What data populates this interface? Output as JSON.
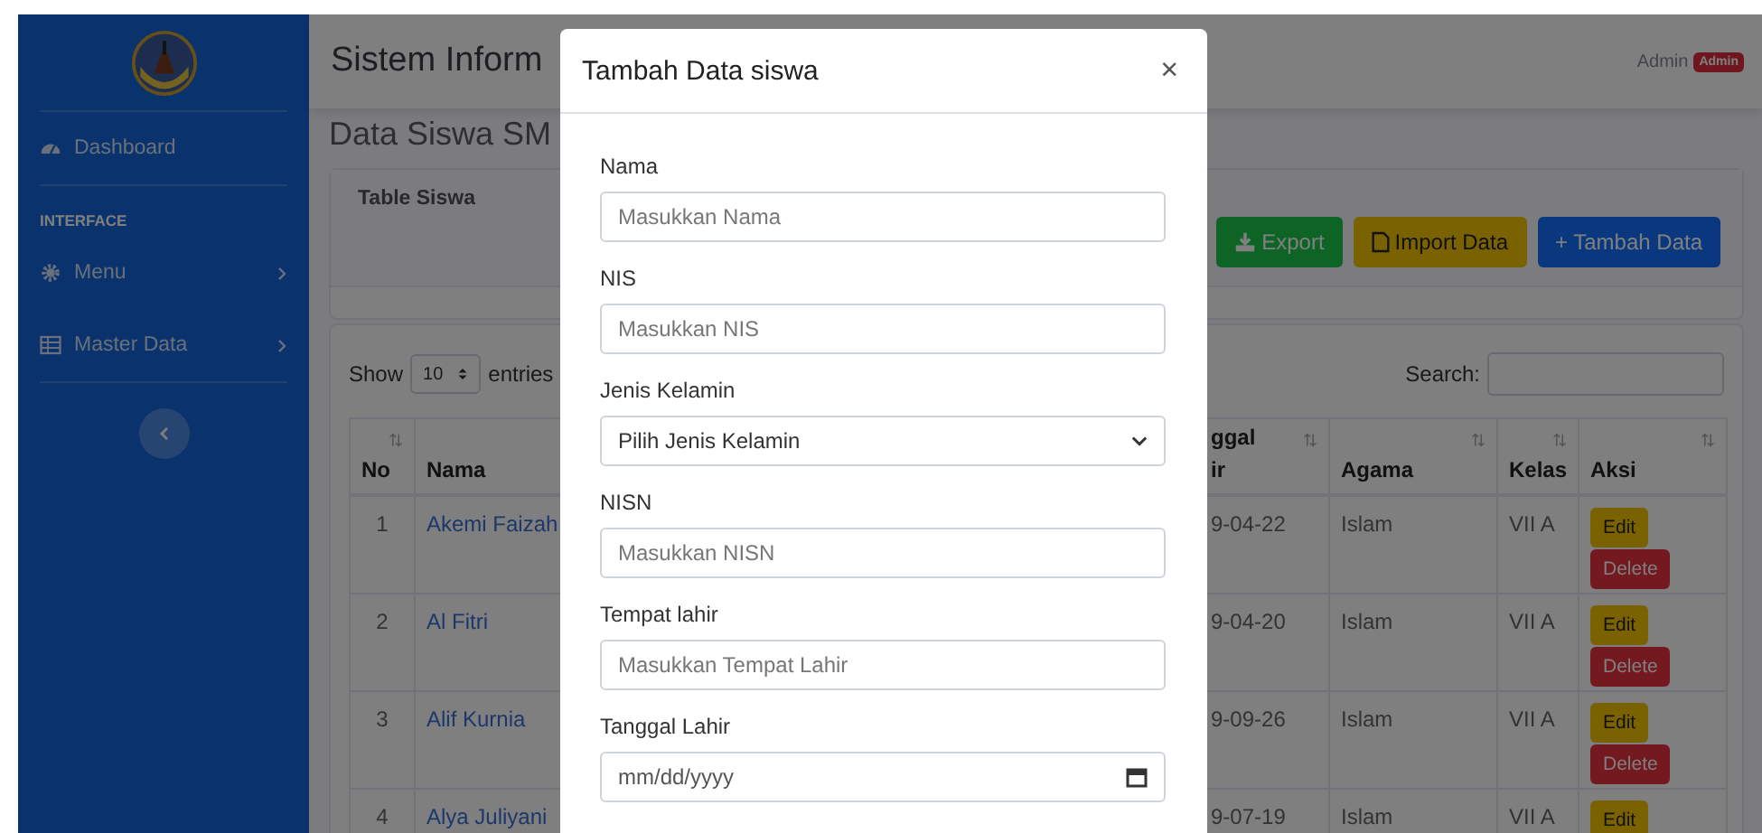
{
  "sidebar": {
    "items": [
      {
        "kind": "dashboard",
        "label": "Dashboard"
      },
      {
        "kind": "heading",
        "label": "INTERFACE"
      },
      {
        "kind": "settings",
        "label": "Menu"
      },
      {
        "kind": "data",
        "label": "Master Data"
      }
    ]
  },
  "topbar": {
    "title": "Sistem Inform",
    "user": "Admin",
    "badge": "Admin"
  },
  "page_title": "Data Siswa SM",
  "card": {
    "title": "Table Siswa",
    "buttons": [
      {
        "kind": "export",
        "label": "Export"
      },
      {
        "kind": "import",
        "label": "Import Data"
      },
      {
        "kind": "add",
        "label": "+ Tambah Data"
      }
    ]
  },
  "table_controls": {
    "show_label": "Show",
    "page_size": "10",
    "entries_label": "entries",
    "search_label": "Search:"
  },
  "table": {
    "columns": [
      {
        "label": "No",
        "sortable": true
      },
      {
        "label": "Nama",
        "sortable": false
      },
      {
        "label": "ggal\nir",
        "sortable": true
      },
      {
        "label": "Agama",
        "sortable": true
      },
      {
        "label": "Kelas",
        "sortable": true
      },
      {
        "label": "Aksi",
        "sortable": true
      }
    ],
    "rows": [
      {
        "no": "1",
        "nama": "Akemi Faizah",
        "tanggal": "9-04-22",
        "agama": "Islam",
        "kelas": "VII A",
        "actions": [
          {
            "kind": "edit",
            "label": "Edit"
          },
          {
            "kind": "delete",
            "label": "Delete"
          }
        ]
      },
      {
        "no": "2",
        "nama": "Al Fitri",
        "tanggal": "9-04-20",
        "agama": "Islam",
        "kelas": "VII A",
        "actions": [
          {
            "kind": "edit",
            "label": "Edit"
          },
          {
            "kind": "delete",
            "label": "Delete"
          }
        ]
      },
      {
        "no": "3",
        "nama": "Alif Kurnia",
        "tanggal": "9-09-26",
        "agama": "Islam",
        "kelas": "VII A",
        "actions": [
          {
            "kind": "edit",
            "label": "Edit"
          },
          {
            "kind": "delete",
            "label": "Delete"
          }
        ]
      },
      {
        "no": "4",
        "nama": "Alya Juliyani",
        "tanggal": "9-07-19",
        "agama": "Islam",
        "kelas": "VII A",
        "actions": [
          {
            "kind": "edit",
            "label": "Edit"
          }
        ]
      }
    ]
  },
  "modal": {
    "title": "Tambah Data siswa",
    "close": "×",
    "fields": [
      {
        "kind": "text",
        "label": "Nama",
        "placeholder": "Masukkan Nama"
      },
      {
        "kind": "text",
        "label": "NIS",
        "placeholder": "Masukkan NIS"
      },
      {
        "kind": "select",
        "label": "Jenis Kelamin",
        "value": "Pilih Jenis Kelamin"
      },
      {
        "kind": "text",
        "label": "NISN",
        "placeholder": "Masukkan NISN"
      },
      {
        "kind": "text",
        "label": "Tempat lahir",
        "placeholder": "Masukkan Tempat Lahir"
      },
      {
        "kind": "date",
        "label": "Tanggal Lahir",
        "placeholder": "mm/dd/yyyy"
      }
    ]
  }
}
